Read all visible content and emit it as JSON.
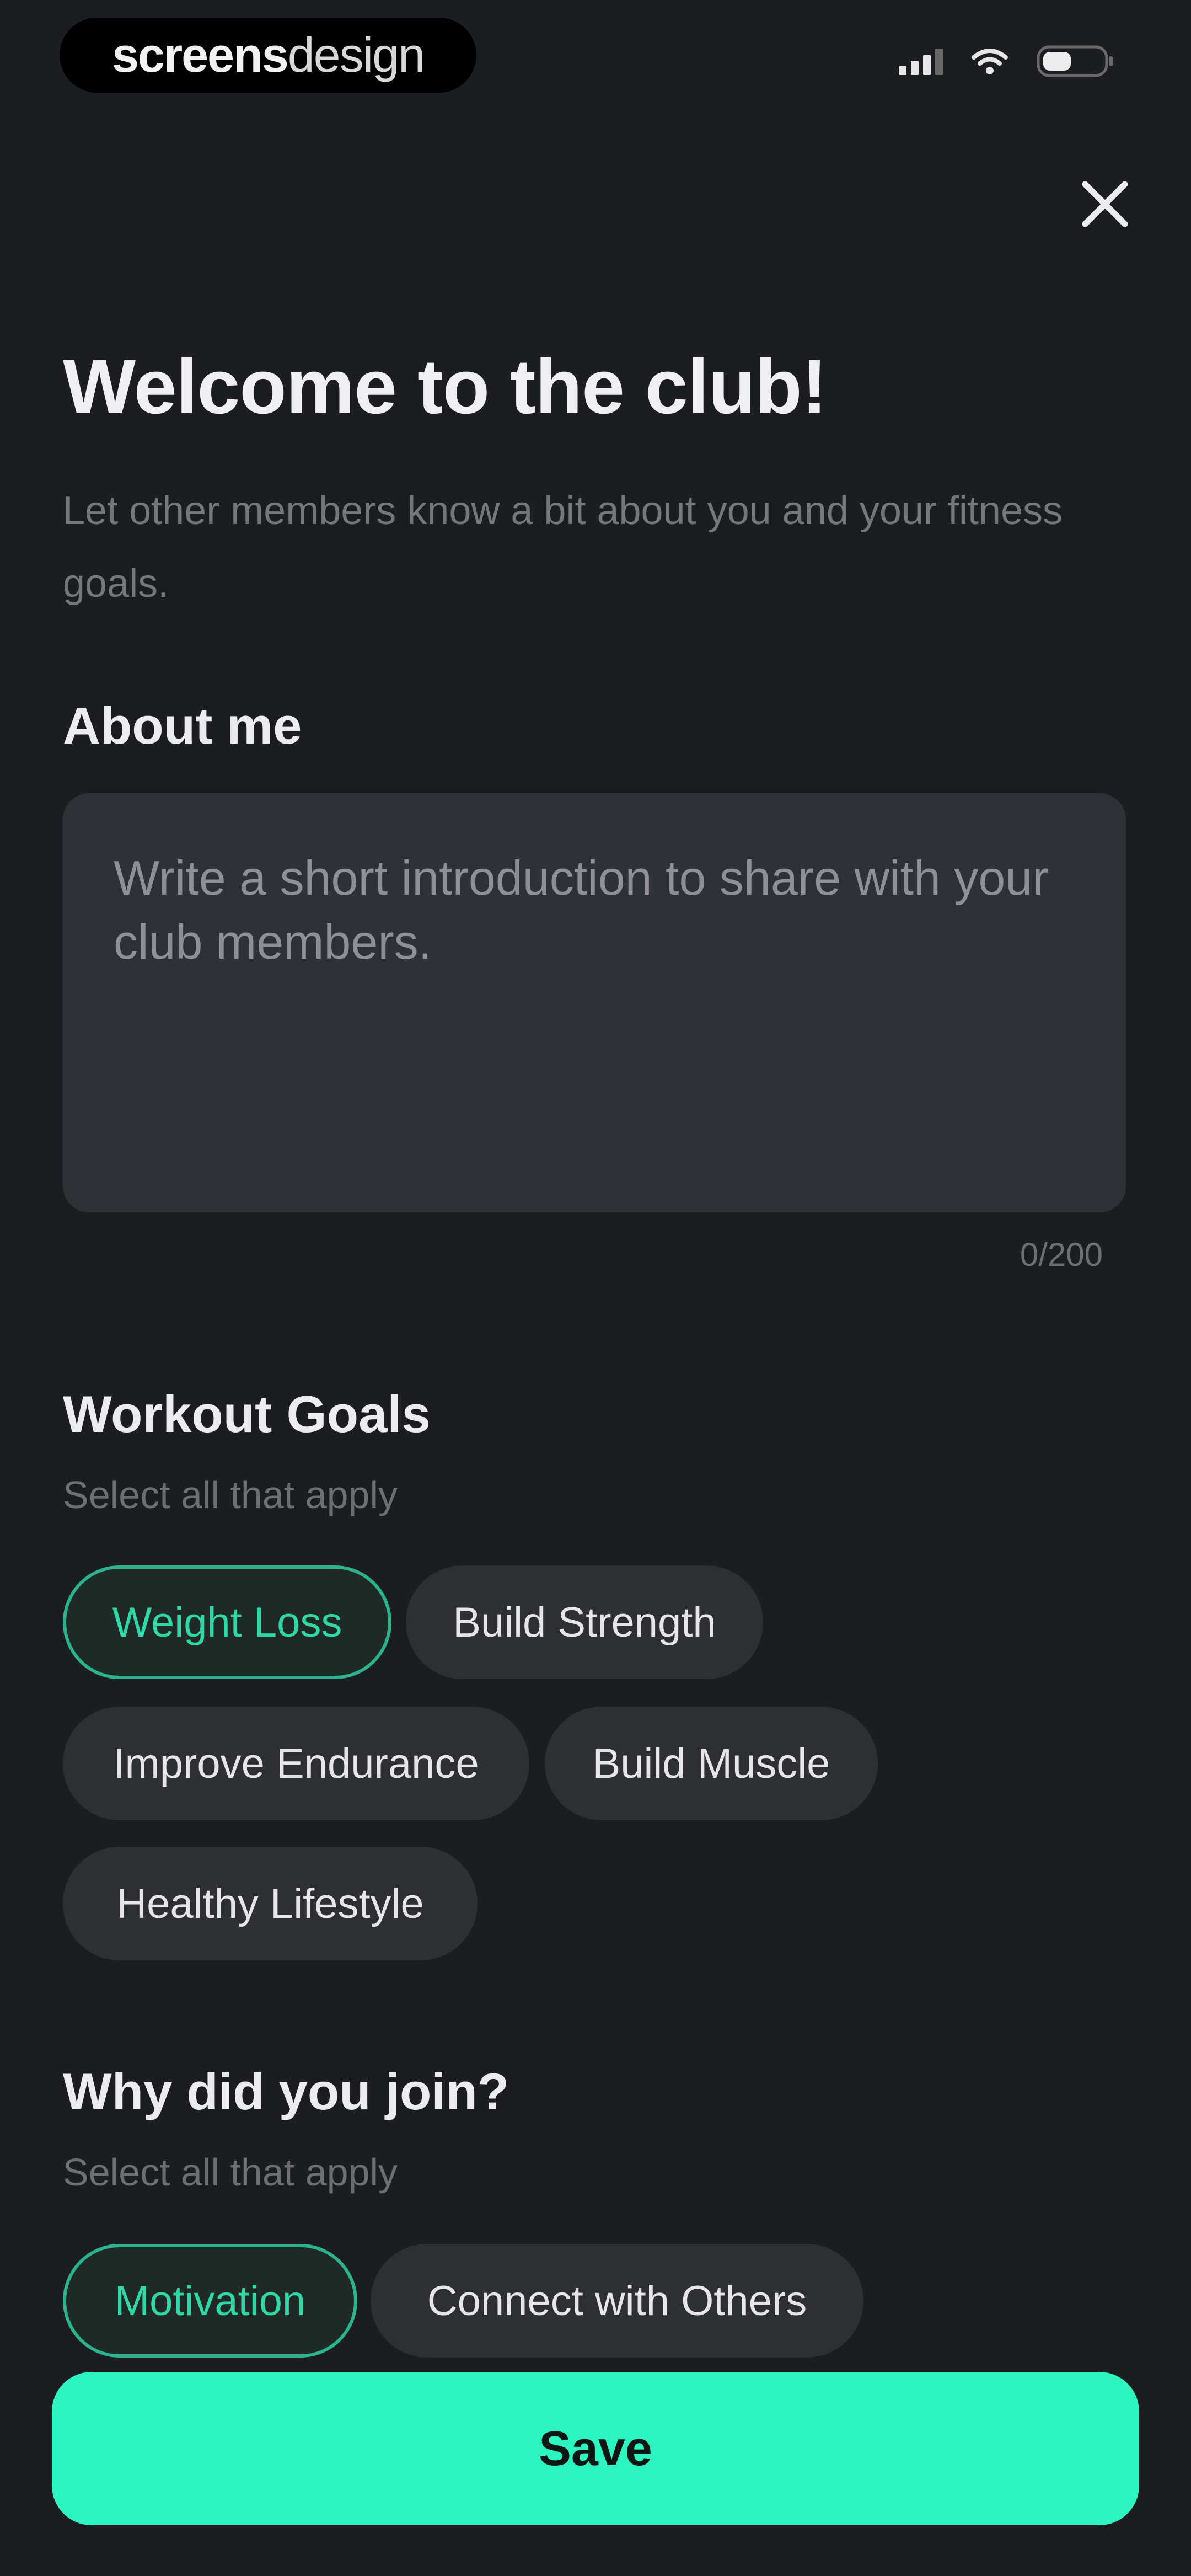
{
  "status_bar": {
    "brand_bold": "screens",
    "brand_light": "design",
    "icons": [
      "signal-icon",
      "wifi-icon",
      "battery-icon"
    ]
  },
  "header": {
    "close_icon": "close-icon",
    "title": "Welcome to the club!",
    "subtitle": "Let other members know a bit about you and your fitness goals."
  },
  "about": {
    "heading": "About me",
    "placeholder": "Write a short introduction to share with your club members.",
    "value": "",
    "char_count": "0/200"
  },
  "workout_goals": {
    "heading": "Workout Goals",
    "hint": "Select all that apply",
    "options": [
      {
        "label": "Weight Loss",
        "selected": true
      },
      {
        "label": "Build Strength",
        "selected": false
      },
      {
        "label": "Improve Endurance",
        "selected": false
      },
      {
        "label": "Build Muscle",
        "selected": false
      },
      {
        "label": "Healthy Lifestyle",
        "selected": false
      }
    ]
  },
  "join_reasons": {
    "heading": "Why did you join?",
    "hint": "Select all that apply",
    "options": [
      {
        "label": "Motivation",
        "selected": true
      },
      {
        "label": "Connect with Others",
        "selected": false
      }
    ]
  },
  "footer": {
    "save_label": "Save"
  },
  "colors": {
    "background": "#1c1d21",
    "accent": "#2cf5c0",
    "accent_text": "#2fd8a6",
    "chip_bg": "#2d2f33",
    "input_bg": "#2f3136"
  }
}
